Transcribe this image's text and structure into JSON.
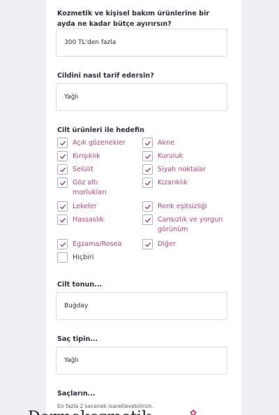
{
  "questions": {
    "budget": {
      "label": "Kozmetik ve kişisel bakım ürünlerine bir ayda ne kadar bütçe ayırırsın?",
      "value": "300 TL'den fazla"
    },
    "skin_desc": {
      "label": "Cildini nasıl tarif edersin?",
      "value": "Yağlı"
    },
    "skin_goals": {
      "label": "Cilt ürünleri ile hedefin",
      "options": [
        {
          "label": "Açık gözenekler",
          "checked": true
        },
        {
          "label": "Akne",
          "checked": true
        },
        {
          "label": "Kırışıklık",
          "checked": true
        },
        {
          "label": "Kuruluk",
          "checked": true
        },
        {
          "label": "Selülit",
          "checked": true
        },
        {
          "label": "Siyah noktalar",
          "checked": true
        },
        {
          "label": "Göz altı morlukları",
          "checked": true
        },
        {
          "label": "Kızarıklık",
          "checked": true
        },
        {
          "label": "Lekeler",
          "checked": true
        },
        {
          "label": "Renk eşitsizliği",
          "checked": true
        },
        {
          "label": "Hassaslık",
          "checked": true
        },
        {
          "label": "Cansızlık ve yorgun görünüm",
          "checked": true
        },
        {
          "label": "Egzama/Rosea",
          "checked": true
        },
        {
          "label": "Diğer",
          "checked": true
        },
        {
          "label": "Hiçbiri",
          "checked": false
        }
      ]
    },
    "skin_tone": {
      "label": "Cilt tonun...",
      "value": "Buğday"
    },
    "hair_type": {
      "label": "Saç tipin...",
      "value": "Yağlı"
    },
    "hair": {
      "label": "Saçların...",
      "hint": "En fazla 2 secenek isaretlevebilirsin."
    }
  },
  "footer": {
    "text": "Dermokozmetik",
    "icon": "flower-icon"
  },
  "colors": {
    "accent": "#b3487d",
    "check": "#8e3a66"
  }
}
